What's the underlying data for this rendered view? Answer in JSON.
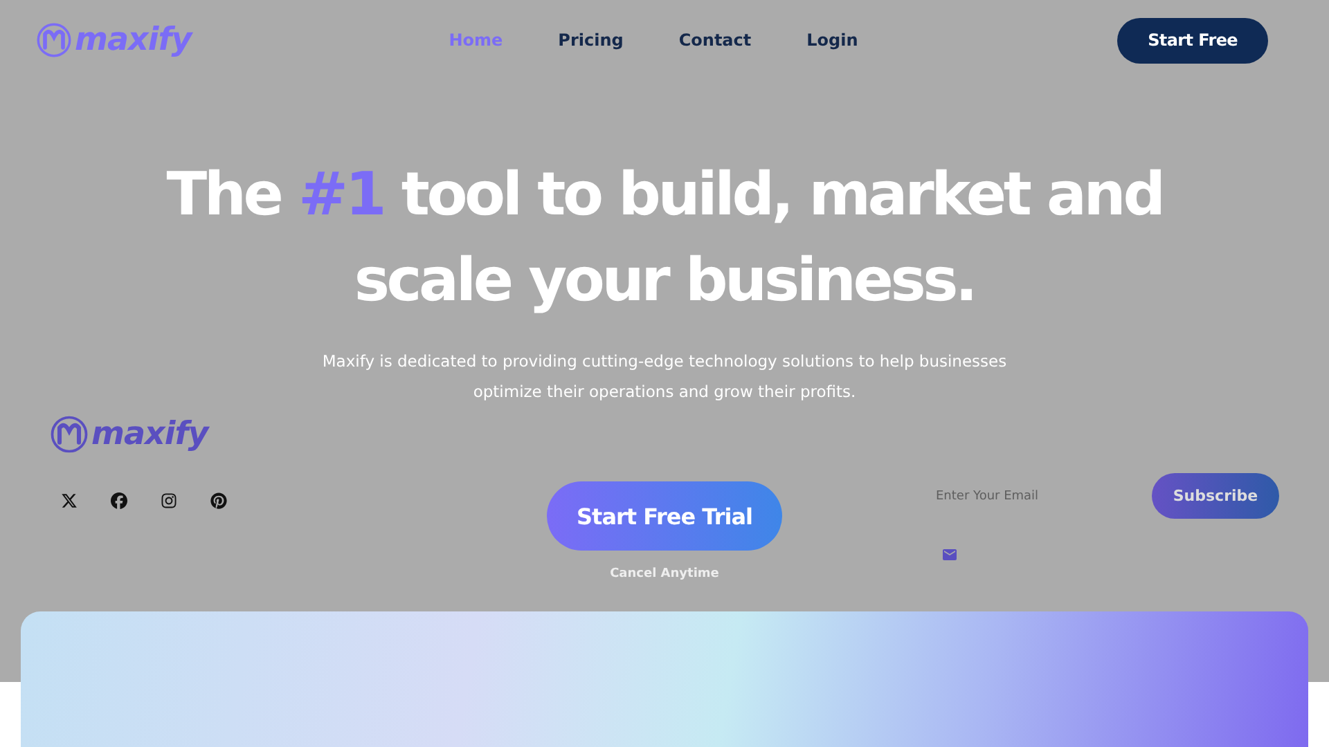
{
  "header": {
    "logo": "maxify",
    "nav": [
      {
        "label": "Home",
        "selected": true
      },
      {
        "label": "Pricing",
        "selected": false
      },
      {
        "label": "Contact",
        "selected": false
      },
      {
        "label": "Login",
        "selected": false
      }
    ],
    "cta": "Start Free"
  },
  "hero": {
    "headline_before": "The ",
    "headline_highlight": "#1",
    "headline_after": " tool to build, market and scale your business.",
    "description": "Maxify is dedicated to providing cutting-edge technology solutions to help businesses optimize their operations and grow their profits."
  },
  "footer_brand": {
    "logo": "maxify"
  },
  "trial": {
    "button": "Start Free Trial",
    "note": "Cancel Anytime"
  },
  "newsletter": {
    "placeholder": "Enter Your Email",
    "button": "Subscribe"
  }
}
